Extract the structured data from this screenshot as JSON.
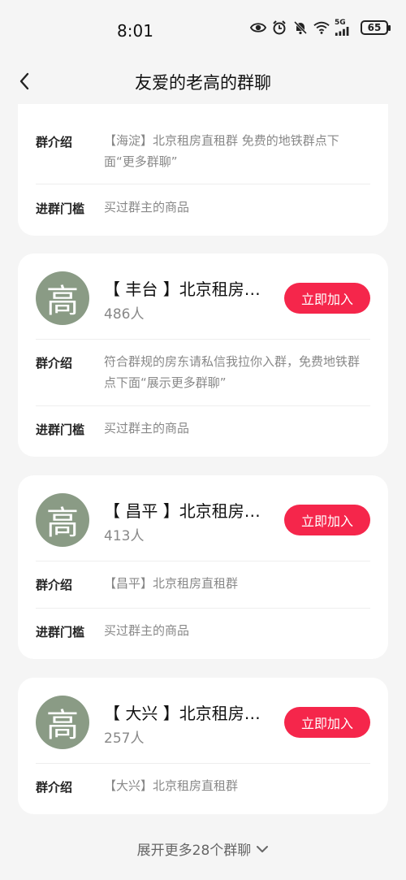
{
  "status_bar": {
    "time": "8:01",
    "network_label": "5G",
    "battery": "65"
  },
  "nav": {
    "title": "友爱的老高的群聊"
  },
  "labels": {
    "intro": "群介绍",
    "threshold": "进群门槛",
    "join": "立即加入"
  },
  "partial_card": {
    "intro": "【海淀】北京租房直租群 免费的地铁群点下面“更多群聊”",
    "threshold": "买过群主的商品"
  },
  "groups": [
    {
      "avatar_char": "高",
      "name": "【 丰台 】北京租房直租群",
      "members": "486人",
      "intro": "符合群规的房东请私信我拉你入群，免费地铁群点下面“展示更多群聊”",
      "threshold": "买过群主的商品"
    },
    {
      "avatar_char": "高",
      "name": "【 昌平 】北京租房直租群",
      "members": "413人",
      "intro": "【昌平】北京租房直租群",
      "threshold": "买过群主的商品"
    },
    {
      "avatar_char": "高",
      "name": "【 大兴 】北京租房直租群",
      "members": "257人",
      "intro": "【大兴】北京租房直租群"
    }
  ],
  "expand_more": "展开更多28个群聊",
  "colors": {
    "accent": "#f5264b",
    "avatar": "#8a9b85",
    "background": "#f5f5f5"
  }
}
